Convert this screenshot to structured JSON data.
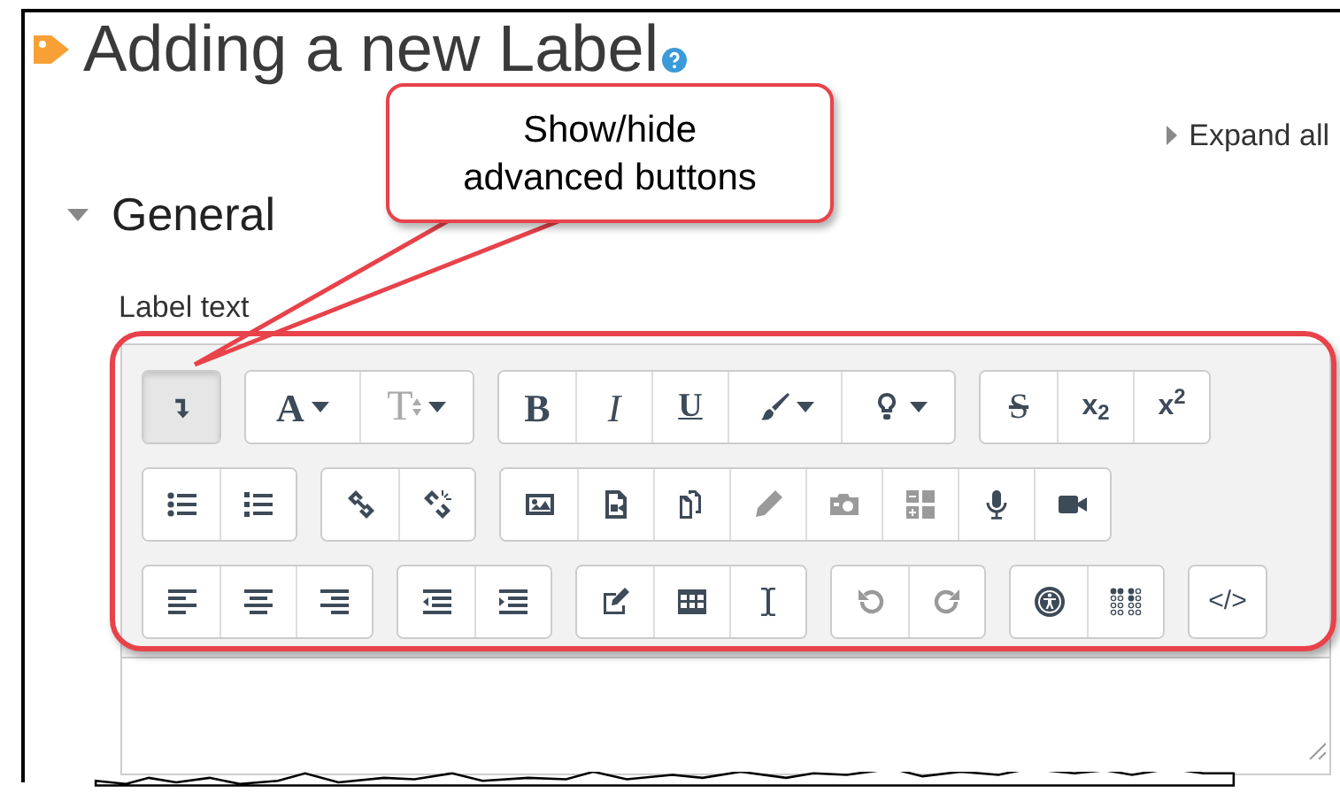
{
  "page": {
    "title": "Adding a new Label",
    "expand_all": "Expand all"
  },
  "section": {
    "title": "General",
    "expanded": true,
    "field_label": "Label text"
  },
  "callout": {
    "text": "Show/hide advanced buttons"
  },
  "toolbar": {
    "rows": [
      {
        "groups": [
          {
            "buttons": [
              {
                "kind": "collapse",
                "pressed": true,
                "disabled": false
              }
            ]
          },
          {
            "buttons": [
              {
                "kind": "font",
                "label": "A",
                "pressed": false,
                "disabled": false
              },
              {
                "kind": "size",
                "label": "T",
                "pressed": false,
                "disabled": false
              }
            ]
          },
          {
            "buttons": [
              {
                "kind": "bold",
                "label": "B",
                "pressed": false,
                "disabled": false
              },
              {
                "kind": "italic",
                "label": "I",
                "pressed": false,
                "disabled": false
              },
              {
                "kind": "underline",
                "label": "U",
                "pressed": false,
                "disabled": false
              },
              {
                "kind": "brush",
                "pressed": false,
                "disabled": false
              },
              {
                "kind": "bulb",
                "pressed": false,
                "disabled": false
              }
            ]
          },
          {
            "buttons": [
              {
                "kind": "strike",
                "label": "S",
                "pressed": false,
                "disabled": false
              },
              {
                "kind": "script",
                "label": "x$_{2}$",
                "pressed": false,
                "disabled": false
              },
              {
                "kind": "script",
                "label": "x$^{2}$",
                "pressed": false,
                "disabled": false
              }
            ]
          }
        ]
      },
      {
        "groups": [
          {
            "buttons": [
              {
                "kind": "ul",
                "pressed": false,
                "disabled": false
              },
              {
                "kind": "ol",
                "pressed": false,
                "disabled": false
              }
            ]
          },
          {
            "buttons": [
              {
                "kind": "link",
                "pressed": false,
                "disabled": false
              },
              {
                "kind": "unlink",
                "pressed": false,
                "disabled": false
              }
            ]
          },
          {
            "buttons": [
              {
                "kind": "image",
                "pressed": false,
                "disabled": false
              },
              {
                "kind": "media",
                "pressed": false,
                "disabled": false
              },
              {
                "kind": "files",
                "pressed": false,
                "disabled": false
              },
              {
                "kind": "pencil",
                "pressed": false,
                "disabled": true
              },
              {
                "kind": "camera",
                "pressed": false,
                "disabled": true
              },
              {
                "kind": "equation",
                "pressed": false,
                "disabled": true
              },
              {
                "kind": "mic",
                "pressed": false,
                "disabled": false
              },
              {
                "kind": "video",
                "pressed": false,
                "disabled": false
              }
            ]
          }
        ]
      },
      {
        "groups": [
          {
            "buttons": [
              {
                "kind": "align-left",
                "pressed": false,
                "disabled": false
              },
              {
                "kind": "align-center",
                "pressed": false,
                "disabled": false
              },
              {
                "kind": "align-right",
                "pressed": false,
                "disabled": false
              }
            ]
          },
          {
            "buttons": [
              {
                "kind": "outdent",
                "pressed": false,
                "disabled": false
              },
              {
                "kind": "indent",
                "pressed": false,
                "disabled": false
              }
            ]
          },
          {
            "buttons": [
              {
                "kind": "edit",
                "pressed": false,
                "disabled": false
              },
              {
                "kind": "table",
                "pressed": false,
                "disabled": false
              },
              {
                "kind": "cursor",
                "pressed": false,
                "disabled": false
              }
            ]
          },
          {
            "buttons": [
              {
                "kind": "undo",
                "pressed": false,
                "disabled": true
              },
              {
                "kind": "redo",
                "pressed": false,
                "disabled": true
              }
            ]
          },
          {
            "buttons": [
              {
                "kind": "accessibility",
                "pressed": false,
                "disabled": false
              },
              {
                "kind": "braille",
                "pressed": false,
                "disabled": false
              }
            ]
          },
          {
            "buttons": [
              {
                "kind": "code",
                "label": "</>",
                "pressed": false,
                "disabled": false
              }
            ]
          }
        ]
      }
    ]
  }
}
